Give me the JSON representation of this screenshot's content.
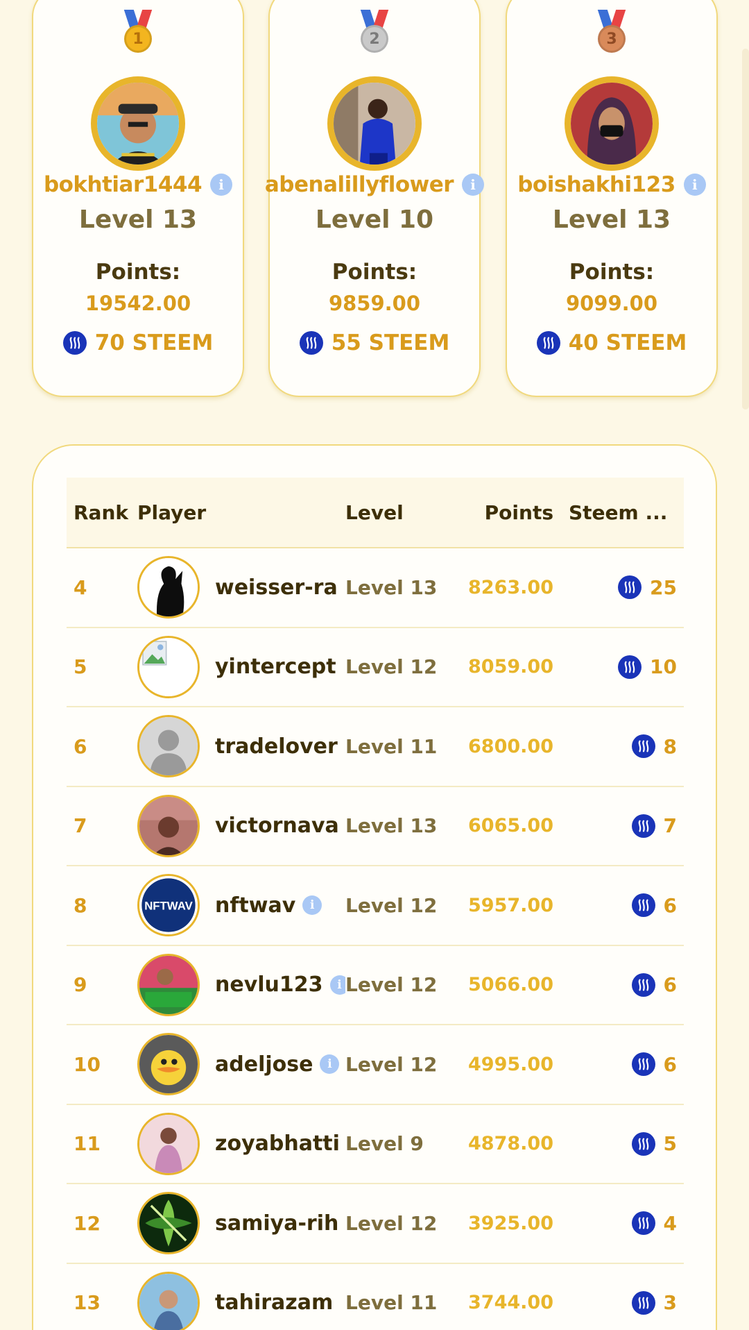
{
  "podium": [
    {
      "rank_medal": "1",
      "username": "bokhtiar1444",
      "level": "Level 13",
      "points_label": "Points:",
      "points": "19542.00",
      "reward": "70 STEEM",
      "medal": "gold"
    },
    {
      "rank_medal": "2",
      "username": "abenalillyflower",
      "level": "Level 10",
      "points_label": "Points:",
      "points": "9859.00",
      "reward": "55 STEEM",
      "medal": "silver"
    },
    {
      "rank_medal": "3",
      "username": "boishakhi123",
      "level": "Level 13",
      "points_label": "Points:",
      "points": "9099.00",
      "reward": "40 STEEM",
      "medal": "bronze"
    }
  ],
  "table": {
    "headers": {
      "rank": "Rank",
      "player": "Player",
      "level": "Level",
      "points": "Points",
      "steem": "Steem ..."
    },
    "rows": [
      {
        "rank": "4",
        "player": "weisser-ra",
        "level": "Level 13",
        "points": "8263.00",
        "steem": "25"
      },
      {
        "rank": "5",
        "player": "yintercept",
        "level": "Level 12",
        "points": "8059.00",
        "steem": "10"
      },
      {
        "rank": "6",
        "player": "tradelover",
        "level": "Level 11",
        "points": "6800.00",
        "steem": "8"
      },
      {
        "rank": "7",
        "player": "victornava",
        "level": "Level 13",
        "points": "6065.00",
        "steem": "7"
      },
      {
        "rank": "8",
        "player": "nftwav",
        "level": "Level 12",
        "points": "5957.00",
        "steem": "6"
      },
      {
        "rank": "9",
        "player": "nevlu123",
        "level": "Level 12",
        "points": "5066.00",
        "steem": "6"
      },
      {
        "rank": "10",
        "player": "adeljose",
        "level": "Level 12",
        "points": "4995.00",
        "steem": "6"
      },
      {
        "rank": "11",
        "player": "zoyabhatti",
        "level": "Level 9",
        "points": "4878.00",
        "steem": "5"
      },
      {
        "rank": "12",
        "player": "samiya-rih",
        "level": "Level 12",
        "points": "3925.00",
        "steem": "4"
      },
      {
        "rank": "13",
        "player": "tahirazam",
        "level": "Level 11",
        "points": "3744.00",
        "steem": "3"
      }
    ]
  },
  "avatar_labels": {
    "nftwav": "NFTWAV"
  },
  "colors": {
    "accent": "#d99b1c",
    "gold_border": "#e8b52b",
    "steem_blue": "#1a34b8",
    "background": "#fdf8e6"
  }
}
